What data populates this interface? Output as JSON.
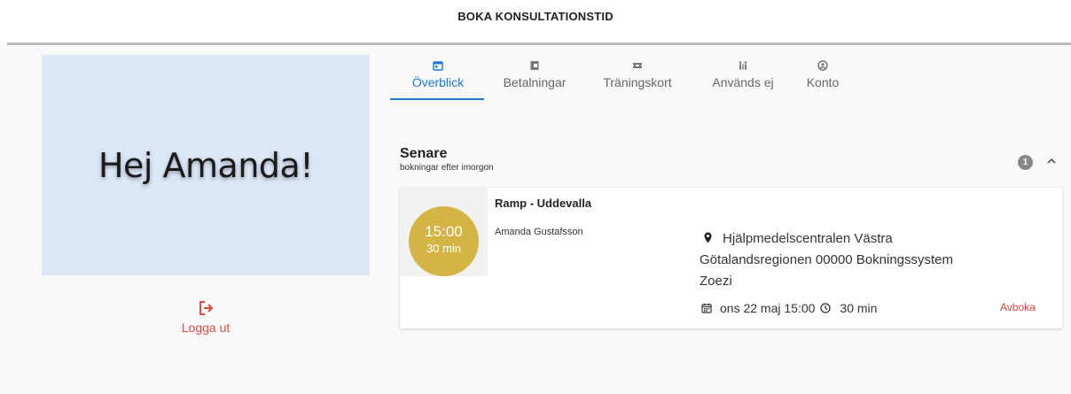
{
  "header": {
    "title": "BOKA KONSULTATIONSTID"
  },
  "greeting": {
    "text": "Hej Amanda!"
  },
  "logout": {
    "label": "Logga ut",
    "icon": "logout-icon"
  },
  "tabs": [
    {
      "label": "Överblick",
      "icon": "calendar-icon",
      "active": true
    },
    {
      "label": "Betalningar",
      "icon": "wallet-icon",
      "active": false
    },
    {
      "label": "Träningskort",
      "icon": "ticket-icon",
      "active": false
    },
    {
      "label": "Används ej",
      "icon": "family-icon",
      "active": false
    },
    {
      "label": "Konto",
      "icon": "account-icon",
      "active": false
    }
  ],
  "section": {
    "title": "Senare",
    "subtitle": "bokningar efter imorgon",
    "count": "1"
  },
  "booking": {
    "time": "15:00",
    "duration": "30 min",
    "title": "Ramp - Uddevalla",
    "person": "Amanda Gustafsson",
    "location": "Hjälpmedelscentralen Västra Götalandsregionen 00000 Bokningssystem Zoezi",
    "date": "ons 22 maj 15:00",
    "length": "30 min",
    "cancel_label": "Avboka"
  },
  "colors": {
    "accent": "#1f78d1",
    "danger": "#e24b3b",
    "time_badge": "#d4b445",
    "greeting_bg": "#dbe6f6"
  }
}
